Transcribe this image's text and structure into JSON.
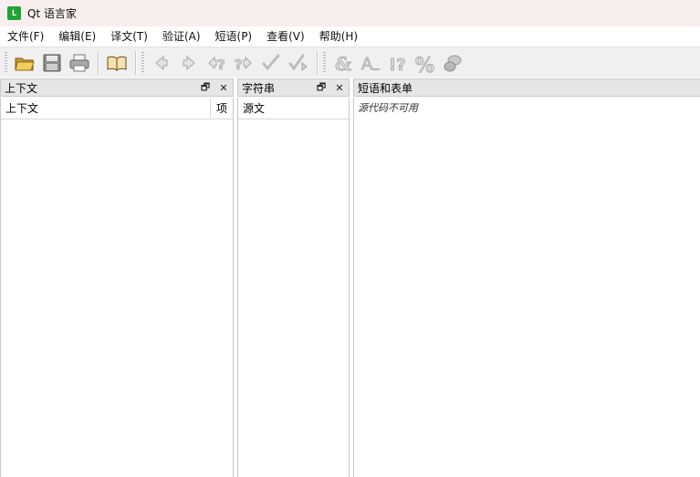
{
  "window": {
    "title": "Qt 语言家",
    "app_icon_letter": "L"
  },
  "menu": [
    "文件(F)",
    "编辑(E)",
    "译文(T)",
    "验证(A)",
    "短语(P)",
    "查看(V)",
    "帮助(H)"
  ],
  "toolbar": {
    "buttons": [
      "open-icon",
      "save-icon",
      "print-icon",
      "phrasebook-icon",
      "prev-icon",
      "next-icon",
      "prev-unfinished-icon",
      "next-unfinished-icon",
      "done-icon",
      "done-next-icon",
      "accelerator-icon",
      "punctuation-icon",
      "phrase-match-icon",
      "placeholder-icon",
      "surrounding-whitespace-icon"
    ]
  },
  "panels": {
    "context": {
      "title": "上下文",
      "col_name": "上下文",
      "col_items": "项",
      "float_glyph": "🗗",
      "close_glyph": "✕"
    },
    "strings": {
      "title": "字符串",
      "col_source": "源文",
      "float_glyph": "🗗",
      "close_glyph": "✕"
    },
    "phrases": {
      "title": "短语和表单",
      "note": "源代码不可用"
    }
  }
}
